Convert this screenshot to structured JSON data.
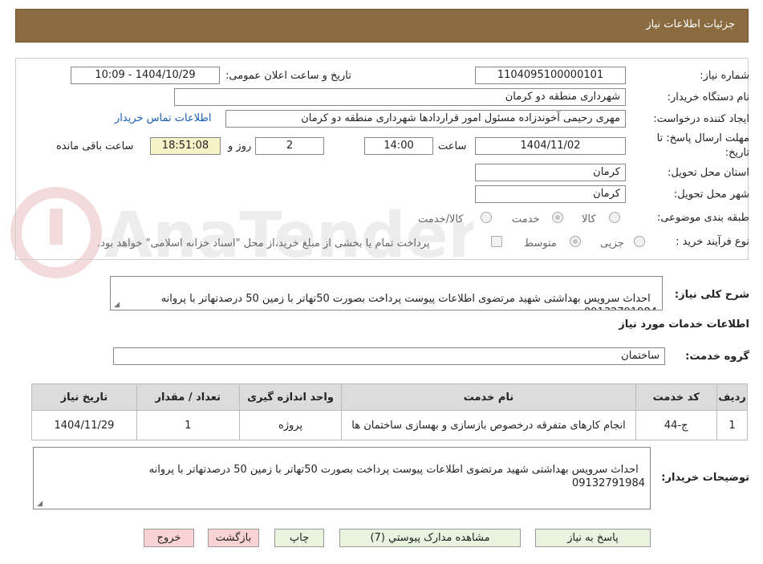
{
  "header": {
    "title": "جزئیات اطلاعات نیاز"
  },
  "fields": {
    "need_number_label": "شماره نیاز:",
    "need_number": "1104095100000101",
    "announce_label": "تاریخ و ساعت اعلان عمومی:",
    "announce_value": "1404/10/29 - 10:09",
    "buyer_org_label": "نام دستگاه خریدار:",
    "buyer_org": "شهرداری منطقه دو کرمان",
    "creator_label": "ایجاد کننده درخواست:",
    "creator": "مهری رحیمی آخوندزاده مسئول امور قراردادها شهرداری منطقه دو کرمان",
    "contact_link": "اطلاعات تماس خریدار",
    "deadline_label_1": "مهلت ارسال پاسخ: تا",
    "deadline_label_2": "تاریخ:",
    "deadline_date": "1404/11/02",
    "time_label": "ساعت",
    "deadline_time": "14:00",
    "days_value": "2",
    "days_label": "روز و",
    "remaining_time": "18:51:08",
    "remaining_label": "ساعت باقی مانده",
    "province_label": "استان محل تحویل:",
    "province": "کرمان",
    "city_label": "شهر محل تحویل:",
    "city": "کرمان",
    "category_label": "طبقه بندی موضوعی:",
    "category_options": [
      "کالا",
      "خدمت",
      "کالا/خدمت"
    ],
    "process_label": "نوع فرآیند خرید :",
    "process_options": [
      "جزیی",
      "متوسط"
    ],
    "payment_note": "پرداخت تمام یا بخشی از مبلغ خرید،از محل \"اسناد خزانه اسلامی\" خواهد بود."
  },
  "description": {
    "label": "شرح کلی نیاز:",
    "text": "احداث سرویس بهداشتی شهید مرتضوی اطلاعات پیوست پرداخت بصورت 50تهاتر با زمین 50 درصدتهاتر با پروانه 09132791984"
  },
  "services_section": {
    "title": "اطلاعات خدمات مورد نیاز",
    "group_label": "گروه خدمت:",
    "group_value": "ساختمان"
  },
  "table": {
    "headers": [
      "ردیف",
      "کد خدمت",
      "نام خدمت",
      "واحد اندازه گیری",
      "تعداد / مقدار",
      "تاریخ نیاز"
    ],
    "rows": [
      [
        "1",
        "ج-44",
        "انجام کارهای متفرقه درخصوص بازسازی و بهسازی ساختمان ها",
        "پروژه",
        "1",
        "1404/11/29"
      ]
    ]
  },
  "buyer_notes": {
    "label": "توضیحات خریدار:",
    "text": "احداث سرویس بهداشتی شهید مرتضوی اطلاعات پیوست پرداخت بصورت 50تهاتر با زمین 50 درصدتهاتر با پروانه\n09132791984"
  },
  "buttons": {
    "reply": "پاسخ به نیاز",
    "attachments": "مشاهده مدارک پیوستي (7)",
    "print": "چاپ",
    "back": "بازگشت",
    "exit": "خروج"
  },
  "watermark": {
    "text": "AnaTender.neT"
  },
  "colors": {
    "header_bg": "#8b6b40",
    "button_green": "#e8f3e0",
    "button_red": "#fad4d4",
    "highlight_yellow": "#f6f2c7",
    "link_blue": "#1a5fb4"
  }
}
